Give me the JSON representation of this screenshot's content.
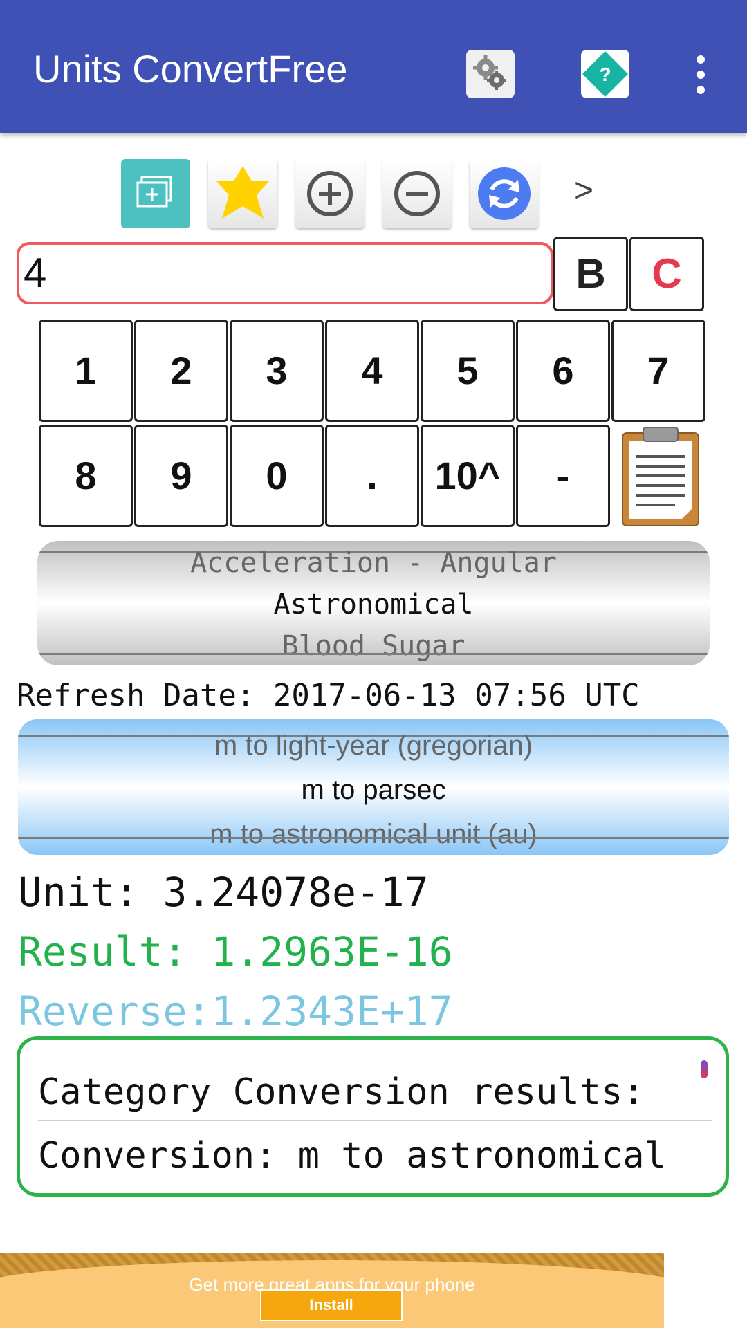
{
  "app_bar": {
    "title": "Units ConvertFree",
    "icons": [
      "settings-gears-icon",
      "help-diamond-icon",
      "more-vert-icon"
    ],
    "color": "#3F51B5"
  },
  "toolbar": {
    "icons": [
      "add-window-icon",
      "favorite-star-icon",
      "zoom-in-icon",
      "zoom-out-icon",
      "refresh-icon"
    ],
    "next_label": ">"
  },
  "input": {
    "value": "4",
    "b_label": "B",
    "c_label": "C"
  },
  "keypad": {
    "row1": [
      "1",
      "2",
      "3",
      "4",
      "5",
      "6",
      "7"
    ],
    "row2": [
      "8",
      "9",
      "0",
      ".",
      "10^",
      "-"
    ],
    "clipboard_icon": "clipboard-icon"
  },
  "category_picker": {
    "prev": "Acceleration - Angular",
    "selected": "Astronomical",
    "next": "Blood Sugar"
  },
  "refresh_date": "Refresh Date: 2017-06-13 07:56 UTC",
  "conversion_picker": {
    "prev": "m to light-year (gregorian)",
    "selected": "m to parsec",
    "next": "m to astronomical unit (au)"
  },
  "output": {
    "unit": "Unit:   3.24078e-17",
    "result": "Result: 1.2963E-16",
    "reverse": "Reverse:1.2343E+17",
    "result_color": "#22B14C",
    "reverse_color": "#7CC6E0"
  },
  "results_box": {
    "line1": "Category Conversion results:",
    "line2": "Conversion: m to astronomical"
  },
  "ad": {
    "text": "Get more great apps for your phone",
    "button": "Install"
  }
}
